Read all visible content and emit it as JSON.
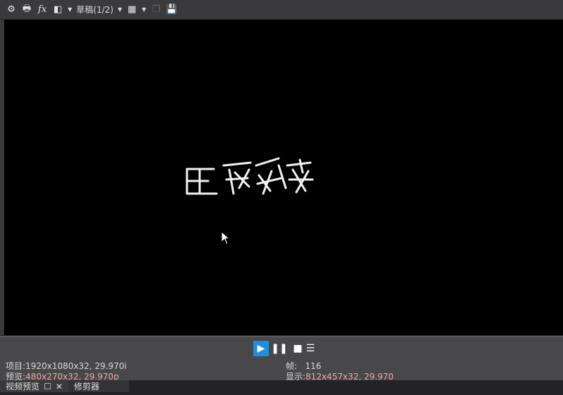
{
  "toolbar": {
    "draft_label": "草稿(1/2)"
  },
  "status": {
    "project_label": "项目:",
    "project_value": "1920x1080x32, 29.970i",
    "preview_label": "预览:",
    "preview_value": "480x270x32, 29.970p",
    "frame_label": "帧:",
    "frame_value": "116",
    "display_label": "显示:",
    "display_value": "812x457x32, 29.970"
  },
  "tabs": [
    {
      "label": "视频预览"
    },
    {
      "label": "修剪器"
    }
  ],
  "colors": {
    "accent": "#1e8fe0",
    "value": "#f0a8a0"
  }
}
